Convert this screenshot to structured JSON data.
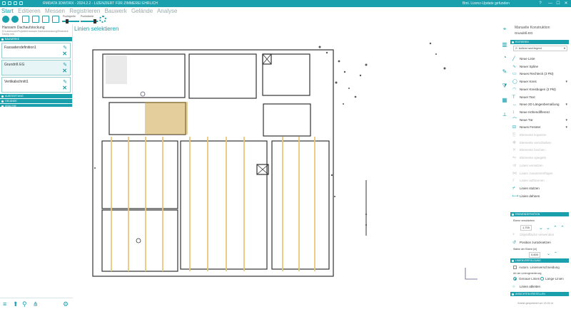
{
  "titlebar": {
    "title": "RMDATA 3DWORX - 2024.2.2 - LIZENZIERT FÜR ZIMMEREI EHRLICH",
    "update_notice": "Bmi. Lizenz-Update gefunden",
    "window_controls": [
      "—",
      "☐",
      "✕"
    ]
  },
  "menu": [
    "Start",
    "Editieren",
    "Messen",
    "Registrieren",
    "Bauwerk",
    "Gelände",
    "Analyse"
  ],
  "toolbar": {
    "point_size_label": "Punktgröße",
    "point_cloud_label": "Punktdichte"
  },
  "left_panel": {
    "title": "Hanswm Dachaufstockung",
    "subtitle": "D:\\Laserscan\\Projekte\\Hanswm Dachaufstockung\\Realwerk Dachp.rmb",
    "section_bauwerke": "BAUWERKE",
    "cards": [
      {
        "name": "Fassadendefinition1",
        "value": ""
      },
      {
        "name": "Grundriß EG",
        "value": ""
      },
      {
        "name": "Vertikalschnitt1",
        "value": ""
      }
    ],
    "sections_bottom": [
      "AUSSTATTUNG",
      "GELÄNDE",
      "ANALYSE"
    ]
  },
  "canvas": {
    "title": "Linien selektieren"
  },
  "right_panel": {
    "header": "Manuelle Konstruktion",
    "subheader": "Grundriß EG",
    "section_editieren": "EDITIEREN",
    "select_value": "Z↑ äußerst rand liegend",
    "items": [
      {
        "label": "Neue Linie",
        "icon": "line-icon",
        "enabled": true,
        "chevron": false
      },
      {
        "label": "Neuer Spline",
        "icon": "spline-icon",
        "enabled": true,
        "chevron": false
      },
      {
        "label": "Neues Rechteck (3 Pkt)",
        "icon": "rectangle-icon",
        "enabled": true,
        "chevron": false
      },
      {
        "label": "Neuer Kreis",
        "icon": "circle-icon",
        "enabled": true,
        "chevron": true
      },
      {
        "label": "Neuer Kreisbogen (3 Pkt)",
        "icon": "arc-icon",
        "enabled": true,
        "chevron": false
      },
      {
        "label": "Neuer Text",
        "icon": "text-icon",
        "enabled": true,
        "chevron": false
      },
      {
        "label": "Neue 2D Längenbemaßung",
        "icon": "dimension-icon",
        "enabled": true,
        "chevron": true
      },
      {
        "label": "Neue Höhendifferenz",
        "icon": "height-icon",
        "enabled": true,
        "chevron": false
      },
      {
        "label": "Neue Tür",
        "icon": "door-icon",
        "enabled": true,
        "chevron": true
      },
      {
        "label": "Neues Fenster",
        "icon": "window-icon",
        "enabled": true,
        "chevron": true
      },
      {
        "label": "Elemente kopieren",
        "icon": "copy-icon",
        "enabled": false,
        "chevron": false
      },
      {
        "label": "Elemente verschieben",
        "icon": "move-icon",
        "enabled": false,
        "chevron": false
      },
      {
        "label": "Elemente löschen",
        "icon": "delete-icon",
        "enabled": false,
        "chevron": false
      },
      {
        "label": "Elemente spiegeln",
        "icon": "mirror-icon",
        "enabled": false,
        "chevron": false
      },
      {
        "label": "Linien versetzen",
        "icon": "offset-icon",
        "enabled": false,
        "chevron": false
      },
      {
        "label": "Linien zusammenfügen",
        "icon": "join-icon",
        "enabled": false,
        "chevron": false
      },
      {
        "label": "Linien auftrennen",
        "icon": "split-icon",
        "enabled": false,
        "chevron": false
      },
      {
        "label": "Linien stutzen",
        "icon": "trim-icon",
        "enabled": true,
        "chevron": false
      },
      {
        "label": "Linien dehnen",
        "icon": "extend-icon",
        "enabled": true,
        "chevron": false
      }
    ],
    "section_ebene": "EBENENDEFINITION",
    "ebene_label": "Ebene verschieben",
    "ebene_value": "1,700",
    "obj_move": "Objektfläche verwenden",
    "reset_position": "Position zurücksetzen",
    "thickness_label": "Stärke der Ebene [m]",
    "thickness_value": "0,600",
    "section_linien": "LINIENVERFOLGUNG",
    "auto_label": "Autom. Linienverschneidung",
    "line_type_label": "Art der Liniengenerierung",
    "radio_a": "Genaue Linien",
    "radio_b": "Lange Linien",
    "derive": "Linien ableiten",
    "section_ansichten": "ANSICHTEN ERSTELLEN"
  },
  "status": "Zuletzt gespeichert um 13:19:14"
}
